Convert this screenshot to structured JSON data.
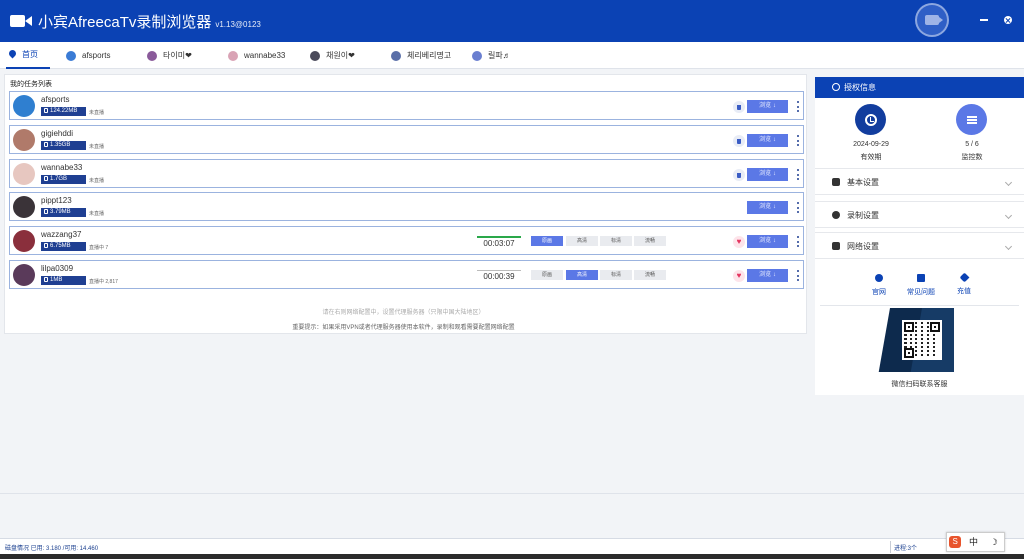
{
  "app": {
    "title": "小宾AfreecaTv录制浏览器",
    "version": "v1.13@0123"
  },
  "tabs": [
    {
      "label": "首页",
      "active": true,
      "color": "#0b42b4"
    },
    {
      "label": "afsports",
      "color": "#3a7bd5"
    },
    {
      "label": "타이미❤",
      "color": "#8a5a9a"
    },
    {
      "label": "wannabe33",
      "color": "#d9a3b5"
    },
    {
      "label": "채원이❤",
      "color": "#4a4a5a"
    },
    {
      "label": "체리베리명고",
      "color": "#5a6fa8"
    },
    {
      "label": "릴파♬",
      "color": "#6a7fd0"
    }
  ],
  "tasks": {
    "title": "我的任务列表",
    "rows": [
      {
        "name": "afsports",
        "size": "124.22MB",
        "status": "未直播",
        "action": "浏览 ↓",
        "avatar_color": "#2f7fd0"
      },
      {
        "name": "gigiehddi",
        "size": "1.35GB",
        "status": "未直播",
        "action": "浏览 ↓",
        "avatar_color": "#b07a6a"
      },
      {
        "name": "wannabe33",
        "size": "1.7GB",
        "status": "未直播",
        "action": "浏览 ↓",
        "avatar_color": "#e7c7c0"
      },
      {
        "name": "pippt123",
        "size": "3.79MB",
        "status": "未直播",
        "action": "浏览 ↓",
        "avatar_color": "#3a3338"
      },
      {
        "name": "wazzang37",
        "size": "6.75MB",
        "status": "直播中 7",
        "action": "浏览 ↓",
        "timer": "00:03:07",
        "avatar_color": "#8a2f3c",
        "qualities": [
          "原画",
          "高清",
          "标清",
          "流畅"
        ],
        "selected_quality": "原画"
      },
      {
        "name": "lilpa0309",
        "size": "1MB",
        "status": "直播中 2,817",
        "action": "浏览 ↓",
        "timer": "00:00:39",
        "avatar_color": "#5a3a5a",
        "qualities": [
          "原画",
          "高清",
          "标清",
          "流畅"
        ],
        "selected_quality": "高清"
      }
    ],
    "notice1": "请在右则网络配置中，设置代理服务器（只限中国大陆地区）",
    "notice2": "重要提示：如果采用VPN或者代理服务器使用本软件，录制和观看需要配置网络配置"
  },
  "sidebar": {
    "auth_title": "授权信息",
    "expiry": {
      "value": "2024-09-29",
      "label": "有效期"
    },
    "monitor": {
      "value": "5 / 6",
      "label": "监控数"
    },
    "sections": [
      {
        "label": "基本设置"
      },
      {
        "label": "录制设置"
      },
      {
        "label": "网络设置"
      }
    ],
    "links": [
      {
        "label": "官网"
      },
      {
        "label": "常见问题"
      },
      {
        "label": "充值"
      }
    ],
    "qr_caption": "微信扫码联系客服"
  },
  "status": {
    "disk": "磁盘情况 已用: 3.180 /可用: 14.460",
    "progress": "进程:3个"
  },
  "corner": {
    "s": "S",
    "lang": "中",
    "moon": "☽"
  },
  "colors": {
    "primary": "#0b42b4",
    "accent": "#5b78e6",
    "badge": "#1f3f92"
  }
}
